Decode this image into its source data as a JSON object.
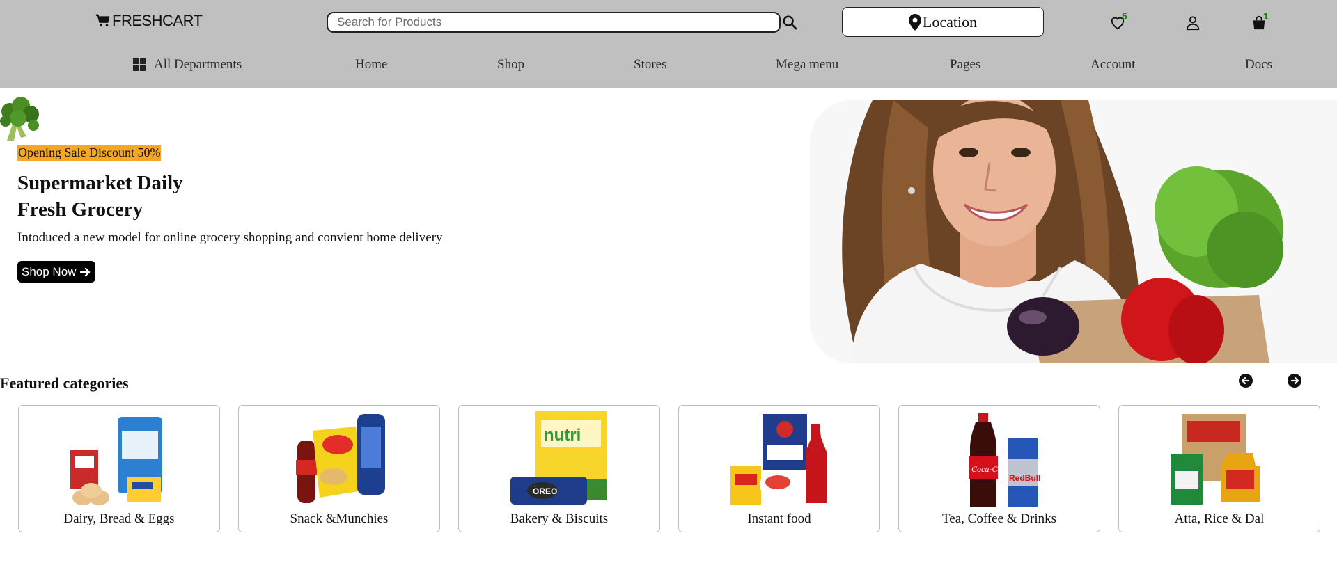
{
  "header": {
    "logo_text": "FRESHCART",
    "search_placeholder": "Search for Products",
    "location_label": "Location",
    "wishlist_count": "5",
    "cart_count": "1",
    "colors": {
      "bar": "#c0c0c0",
      "badge": "#0a8a0a"
    }
  },
  "nav": {
    "items": [
      {
        "label": "All Departments",
        "icon": "grid-icon"
      },
      {
        "label": "Home"
      },
      {
        "label": "Shop"
      },
      {
        "label": "Stores"
      },
      {
        "label": "Mega menu"
      },
      {
        "label": "Pages"
      },
      {
        "label": "Account"
      },
      {
        "label": "Docs"
      }
    ]
  },
  "hero": {
    "badge": "Opening Sale Discount 50%",
    "title_line1": "Supermarket Daily",
    "title_line2": "Fresh Grocery",
    "description": "Intoduced a new model for online grocery shopping and convient home delivery",
    "button_label": "Shop Now",
    "colors": {
      "badge": "#f5a623",
      "button": "#000000"
    }
  },
  "featured": {
    "title": "Featured categories",
    "categories": [
      {
        "label": "Dairy, Bread & Eggs"
      },
      {
        "label": "Snack &Munchies"
      },
      {
        "label": "Bakery & Biscuits"
      },
      {
        "label": "Instant food"
      },
      {
        "label": "Tea, Coffee & Drinks"
      },
      {
        "label": "Atta, Rice & Dal"
      }
    ]
  }
}
